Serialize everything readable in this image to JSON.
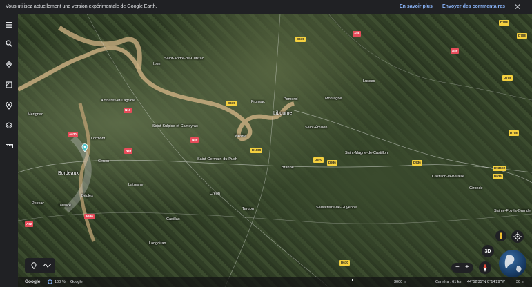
{
  "banner": {
    "message": "Vous utilisez actuellement une version expérimentale de Google Earth.",
    "learn_more": "En savoir plus",
    "feedback": "Envoyer des commentaires",
    "close": "✕"
  },
  "sidebar": {
    "icons": [
      "menu-icon",
      "search-icon",
      "voyager-icon",
      "projects-icon",
      "places-icon",
      "layers-icon",
      "ruler-icon"
    ]
  },
  "map": {
    "labels": [
      {
        "text": "Saint-André-de-Cubzac",
        "cls": ""
      },
      {
        "text": "Libourne",
        "cls": "big"
      },
      {
        "text": "Bordeaux",
        "cls": "big"
      },
      {
        "text": "Bègles",
        "cls": ""
      },
      {
        "text": "Lormont",
        "cls": ""
      },
      {
        "text": "Cenon",
        "cls": ""
      },
      {
        "text": "Ambarès-et-Lagrave",
        "cls": ""
      },
      {
        "text": "Saint-Sulpice-et-Cameyrac",
        "cls": ""
      },
      {
        "text": "Saint-Germain-du-Puch",
        "cls": ""
      },
      {
        "text": "Pomerol",
        "cls": ""
      },
      {
        "text": "Saint-Émilion",
        "cls": ""
      },
      {
        "text": "Castillon-la-Bataille",
        "cls": ""
      },
      {
        "text": "Saint-Magne-de-Castillon",
        "cls": ""
      },
      {
        "text": "Branne",
        "cls": ""
      },
      {
        "text": "Créon",
        "cls": ""
      },
      {
        "text": "Cadillac",
        "cls": ""
      },
      {
        "text": "Targon",
        "cls": ""
      },
      {
        "text": "Sauveterre-de-Guyenne",
        "cls": ""
      },
      {
        "text": "Pessac",
        "cls": ""
      },
      {
        "text": "Talence",
        "cls": ""
      },
      {
        "text": "Gironde",
        "cls": ""
      },
      {
        "text": "Montagne",
        "cls": ""
      },
      {
        "text": "Lussac",
        "cls": ""
      },
      {
        "text": "Fronsac",
        "cls": ""
      },
      {
        "text": "Izon",
        "cls": ""
      },
      {
        "text": "Vayres",
        "cls": ""
      },
      {
        "text": "Latresne",
        "cls": ""
      },
      {
        "text": "Langoiran",
        "cls": ""
      },
      {
        "text": "Mérignac",
        "cls": ""
      },
      {
        "text": "Sainte-Foy-la-Grande",
        "cls": ""
      }
    ],
    "shields": [
      {
        "text": "D670",
        "color": "y"
      },
      {
        "text": "A89",
        "color": "r"
      },
      {
        "text": "A89",
        "color": "r"
      },
      {
        "text": "D708",
        "color": "y"
      },
      {
        "text": "D670",
        "color": "y"
      },
      {
        "text": "D1089",
        "color": "y"
      },
      {
        "text": "A630",
        "color": "r"
      },
      {
        "text": "N10",
        "color": "r"
      },
      {
        "text": "N89",
        "color": "r"
      },
      {
        "text": "N89",
        "color": "r"
      },
      {
        "text": "D670",
        "color": "y"
      },
      {
        "text": "D936",
        "color": "y"
      },
      {
        "text": "D936",
        "color": "y"
      },
      {
        "text": "D708",
        "color": "y"
      },
      {
        "text": "D936E2",
        "color": "y"
      },
      {
        "text": "D936",
        "color": "y"
      },
      {
        "text": "D708",
        "color": "y"
      },
      {
        "text": "A630",
        "color": "r"
      },
      {
        "text": "A62",
        "color": "r"
      },
      {
        "text": "D670",
        "color": "y"
      },
      {
        "text": "D708",
        "color": "y"
      }
    ]
  },
  "controls": {
    "btn_3d": "3D",
    "zoom_out": "−",
    "zoom_in": "+"
  },
  "status": {
    "google": "Google",
    "zoom_percent": "100 %",
    "attribution": "Google",
    "scale": "3000 m",
    "camera": "Caméra : 61 km",
    "coords": "44°52'35\"N 0°14'29\"W",
    "elevation": "30 m"
  },
  "colors": {
    "accent": "#8ab4f8",
    "ui_bg": "#202124",
    "shield_yellow": "#f4d03f",
    "shield_red": "#e74c5a"
  }
}
